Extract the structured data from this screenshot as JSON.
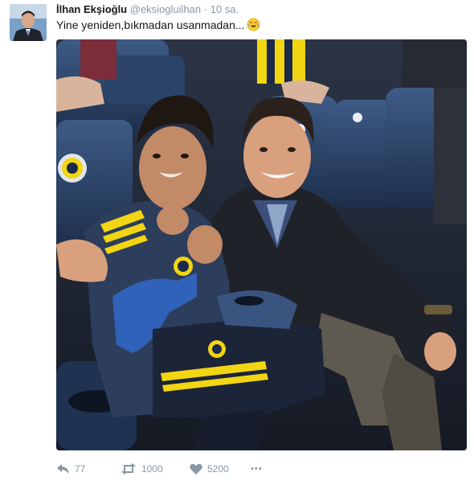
{
  "tweet": {
    "author_name": "İlhan Ekşioğlu",
    "author_handle": "@eksiogluilhan",
    "separator": "·",
    "timestamp": "10 sa.",
    "text": "Yine yeniden,bıkmadan usanmadan...",
    "emoji_icon": "face-with-tears-of-joy-icon",
    "media_description_icon": "photo-icon"
  },
  "actions": {
    "reply": {
      "icon": "reply-icon",
      "count": "77"
    },
    "retweet": {
      "icon": "retweet-icon",
      "count": "1000"
    },
    "like": {
      "icon": "heart-icon",
      "count": "5200"
    },
    "more": {
      "icon": "more-icon",
      "label": "•••"
    }
  },
  "colors": {
    "text_primary": "#14171a",
    "text_secondary": "#8899a6",
    "fenerbahce_navy": "#1b2a4a",
    "fenerbahce_yellow": "#f2d513"
  }
}
